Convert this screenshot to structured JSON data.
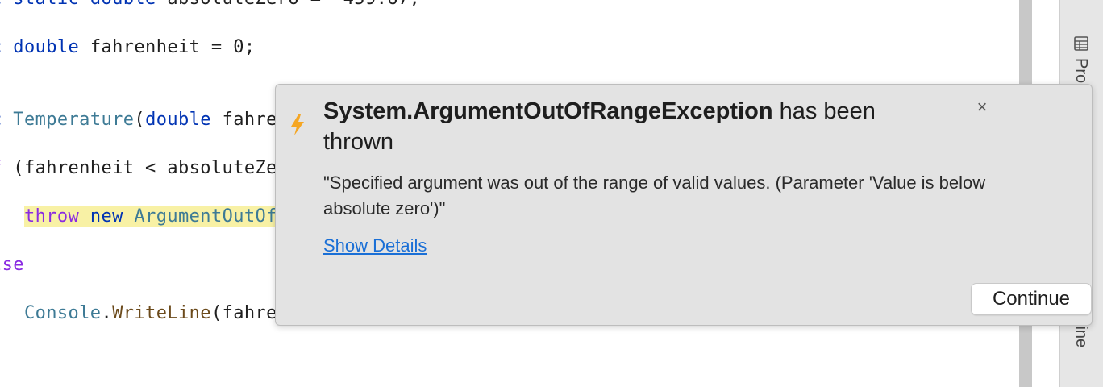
{
  "editor": {
    "lines": [
      {
        "parts": [
          {
            "text": "c ",
            "cls": "kw"
          },
          {
            "text": "static double",
            "cls": "kw"
          },
          {
            "text": " absoluteZero = -459.67;",
            "cls": ""
          }
        ]
      },
      {
        "parts": [
          {
            "text": "c ",
            "cls": "kw"
          },
          {
            "text": "double",
            "cls": "kw"
          },
          {
            "text": " fahrenheit = 0;",
            "cls": ""
          }
        ]
      },
      {
        "parts": [
          {
            "text": "c ",
            "cls": "kw"
          },
          {
            "text": "Temperature",
            "cls": "type"
          },
          {
            "text": "(",
            "cls": ""
          },
          {
            "text": "double",
            "cls": "kw"
          },
          {
            "text": " fahrenheit)",
            "cls": ""
          }
        ]
      },
      {
        "parts": [
          {
            "text": "f",
            "cls": "kw2"
          },
          {
            "text": " (fahrenheit < absoluteZero)",
            "cls": ""
          }
        ]
      },
      {
        "parts": [
          {
            "text": "   ",
            "cls": ""
          },
          {
            "text": "throw",
            "cls": "kw-throw hl"
          },
          {
            "text": " ",
            "cls": "hl"
          },
          {
            "text": "new",
            "cls": "kw hl"
          },
          {
            "text": " ",
            "cls": "hl"
          },
          {
            "text": "ArgumentOutOfRangeException",
            "cls": "type hl"
          }
        ]
      },
      {
        "parts": [
          {
            "text": "lse",
            "cls": "kw2"
          }
        ]
      },
      {
        "parts": [
          {
            "text": "   ",
            "cls": ""
          },
          {
            "text": "Console",
            "cls": "type"
          },
          {
            "text": ".",
            "cls": ""
          },
          {
            "text": "WriteLine",
            "cls": "meth"
          },
          {
            "text": "(fahrenheit);",
            "cls": ""
          }
        ]
      }
    ]
  },
  "side_panel": {
    "tab_top": "Pro",
    "tab_bottom": "line"
  },
  "popup": {
    "exception_name": "System.ArgumentOutOfRangeException",
    "title_suffix": " has been thrown",
    "message": "\"Specified argument was out of the range of valid values. (Parameter 'Value is below absolute zero')\"",
    "details_link": "Show Details",
    "close_label": "×",
    "continue_label": "Continue"
  },
  "colors": {
    "accent_link": "#1a6fd6",
    "bolt": "#f5a623",
    "highlight": "#f8f1a5"
  }
}
